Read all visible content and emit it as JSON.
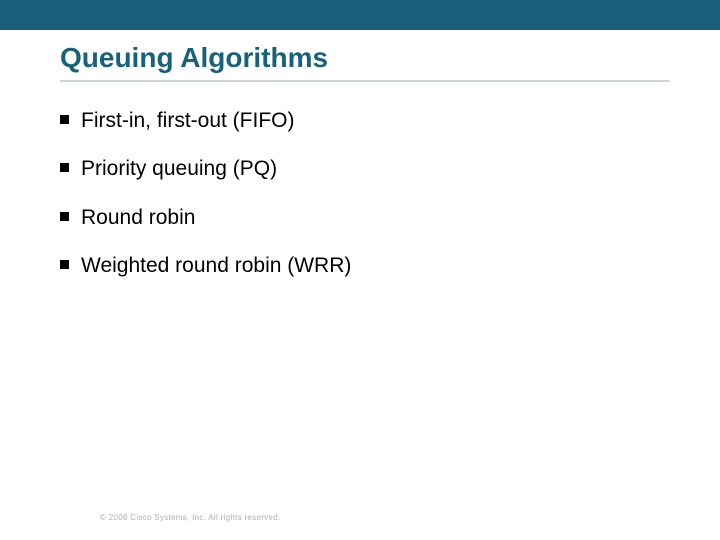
{
  "slide": {
    "title": "Queuing Algorithms",
    "bullets": [
      "First-in, first-out (FIFO)",
      "Priority queuing (PQ)",
      "Round robin",
      "Weighted round robin (WRR)"
    ],
    "footer": "© 2006 Cisco Systems, Inc. All rights reserved."
  }
}
